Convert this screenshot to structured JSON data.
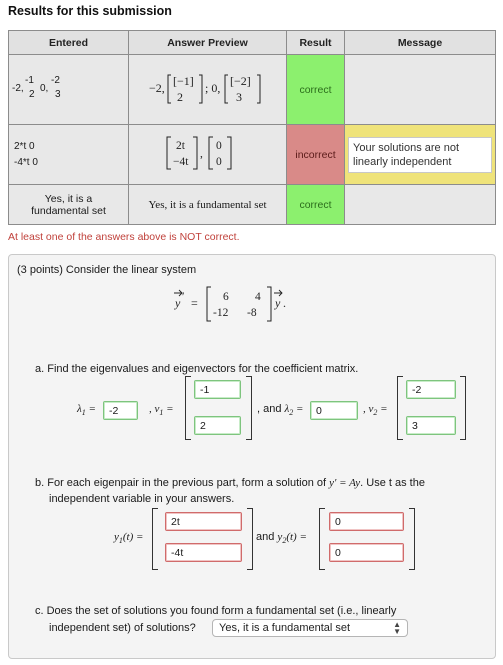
{
  "title": "Results for this submission",
  "table": {
    "headers": [
      "Entered",
      "Answer Preview",
      "Result",
      "Message"
    ],
    "rows": [
      {
        "entered": "-2,-1 2 0,-2 3",
        "result": "correct",
        "message": ""
      },
      {
        "entered_line1": "2*t 0",
        "entered_line2": "-4*t 0",
        "result": "incorrect",
        "message": "Your solutions are not linearly independent"
      },
      {
        "entered": "Yes, it is a fundamental set",
        "preview": "Yes, it is a fundamental set",
        "result": "correct",
        "message": ""
      }
    ]
  },
  "warning": "At least one of the answers above is NOT correct.",
  "problem": {
    "intro": "(3 points) Consider the linear system",
    "matrix": [
      "6",
      "4",
      "-12",
      "-8"
    ],
    "part_a": "a. Find the eigenvalues and eigenvectors for the coefficient matrix.",
    "lambda1": "-2",
    "v1_top": "-1",
    "v1_bot": "2",
    "and_label": ", and",
    "lambda2": "0",
    "v2_top": "-2",
    "v2_bot": "3",
    "part_b_line1": "b. For each eigenpair in the previous part, form a solution of",
    "part_b_line1_end": ". Use t as the",
    "part_b_line2": "independent variable in your answers.",
    "y1_top": "2t",
    "y1_bot": "-4t",
    "and_y2": "and",
    "y2_top": "0",
    "y2_bot": "0",
    "part_c_line1": "c. Does the set of solutions you found form a fundamental set (i.e., linearly",
    "part_c_line2": "independent set) of solutions?",
    "select_value": "Yes, it is a fundamental set"
  },
  "colors": {
    "correct": "#8cf06e",
    "incorrect": "#d98a88",
    "warning_text": "#c0413b",
    "message_bg": "#efe37a"
  }
}
